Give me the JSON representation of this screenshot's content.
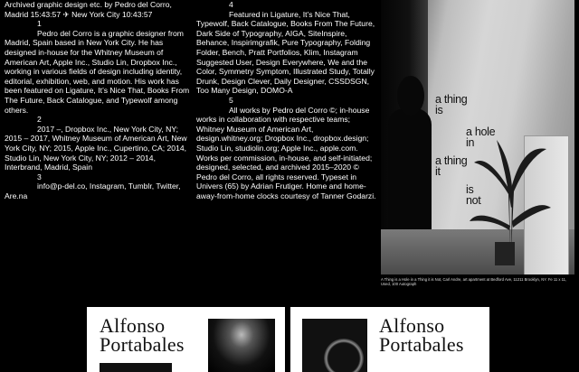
{
  "col1": {
    "intro": "Archived graphic design etc. by Pedro del Corro,",
    "timeline": "Madrid 15:43:57 ✈ New York City 10:43:57",
    "n1": "1",
    "bio": "Pedro del Corro is a graphic designer from Madrid, Spain based in New York City. He has designed in-house for the Whitney Museum of American Art, Apple Inc., Studio Lin, Dropbox Inc., working in various fields of design including identity, editorial, exhibition, web, and motion. His work has been featured on Ligature, It’s Nice That, Books From The Future, Back Catalogue, and Typewolf among others.",
    "n2": "2",
    "cv": "2017 –, Dropbox Inc., New York City, NY; 2015 – 2017, Whitney Museum of American Art, New York City, NY; 2015, Apple Inc., Cupertino, CA; 2014, Studio Lin, New York City, NY; 2012 – 2014, Interbrand, Madrid, Spain",
    "n3": "3",
    "contact": "info@p-del.co, Instagram, Tumblr, Twitter, Are.na"
  },
  "col2": {
    "n4": "4",
    "featured": "Featured in Ligature, It’s Nice That, Typewolf, Back Catalogue, Books From The Future, Dark Side of Typography, AIGA, SiteInspire, Behance, Inspirimgrafik, Pure Typography, Folding Folder, Bench, Pratt Portfolios, Klim, Instagram Suggested User, Design Everywhere, We and the Color, Symmetry Symptom, Illustrated Study, Totally Drunk, Design Clever, Daily Designer, CSSDSGN, Too Many Design, DOMO-A",
    "n5": "5",
    "rights": "All works by Pedro del Corro ©; in-house works in collaboration with respective teams; Whitney Museum of American Art, design.whitney.org; Dropbox Inc., dropbox.design; Studio Lin, studiolin.org; Apple Inc., apple.com. Works per commission, in-house, and self-initiated; designed, selected, and archived 2015–2020 © Pedro del Corro, all rights reserved. Typeset in Univers (65) by Adrian Frutiger. Home and home-away-from-home clocks courtesy of Tanner Godarzi."
  },
  "photo": {
    "wall_text_1": [
      "a thing",
      "is"
    ],
    "wall_text_2": [
      "a hole",
      "in"
    ],
    "wall_text_3": [
      "a thing",
      "it"
    ],
    "wall_text_4": [
      "is",
      "not"
    ],
    "caption": "A Thing is a Hole in a Thing it is Not, Carl Andre, art apartment at Bedford Ave, 11211 Brooklyn, NY. Fe 11 x 11, Used, 100 Autograph"
  },
  "cards": [
    {
      "title_line1": "Alfonso",
      "title_line2": "Portabales"
    },
    {
      "title_line1": "Alfonso",
      "title_line2": "Portabales"
    }
  ]
}
